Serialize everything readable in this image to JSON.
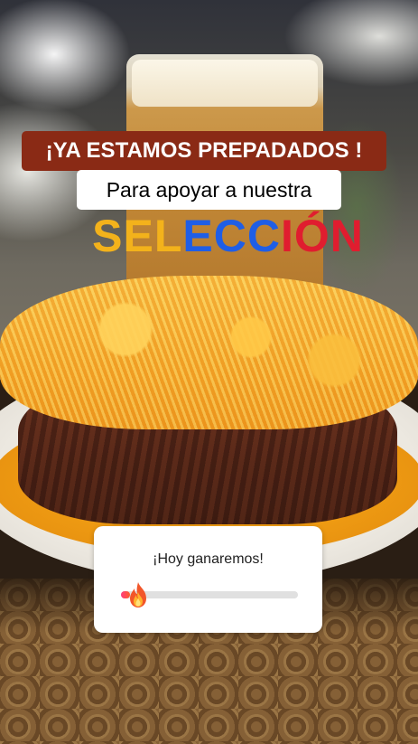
{
  "story": {
    "headline": "¡YA ESTAMOS PREPADADOS !",
    "subline": "Para apoyar a nuestra",
    "seleccion_letters": [
      {
        "text": "SEL",
        "color": "#f3b21b"
      },
      {
        "text": "ECC",
        "color": "#1f5ee6"
      },
      {
        "text": "IÓN",
        "color": "#e01d2f"
      }
    ]
  },
  "poll": {
    "question": "¡Hoy ganaremos!",
    "slider_emoji": "fire-emoji",
    "slider_value_fraction": 0.05,
    "accent_color": "#ff3d7f"
  },
  "colors": {
    "headline_bg": "#8a2a15",
    "subline_bg": "#ffffff"
  }
}
